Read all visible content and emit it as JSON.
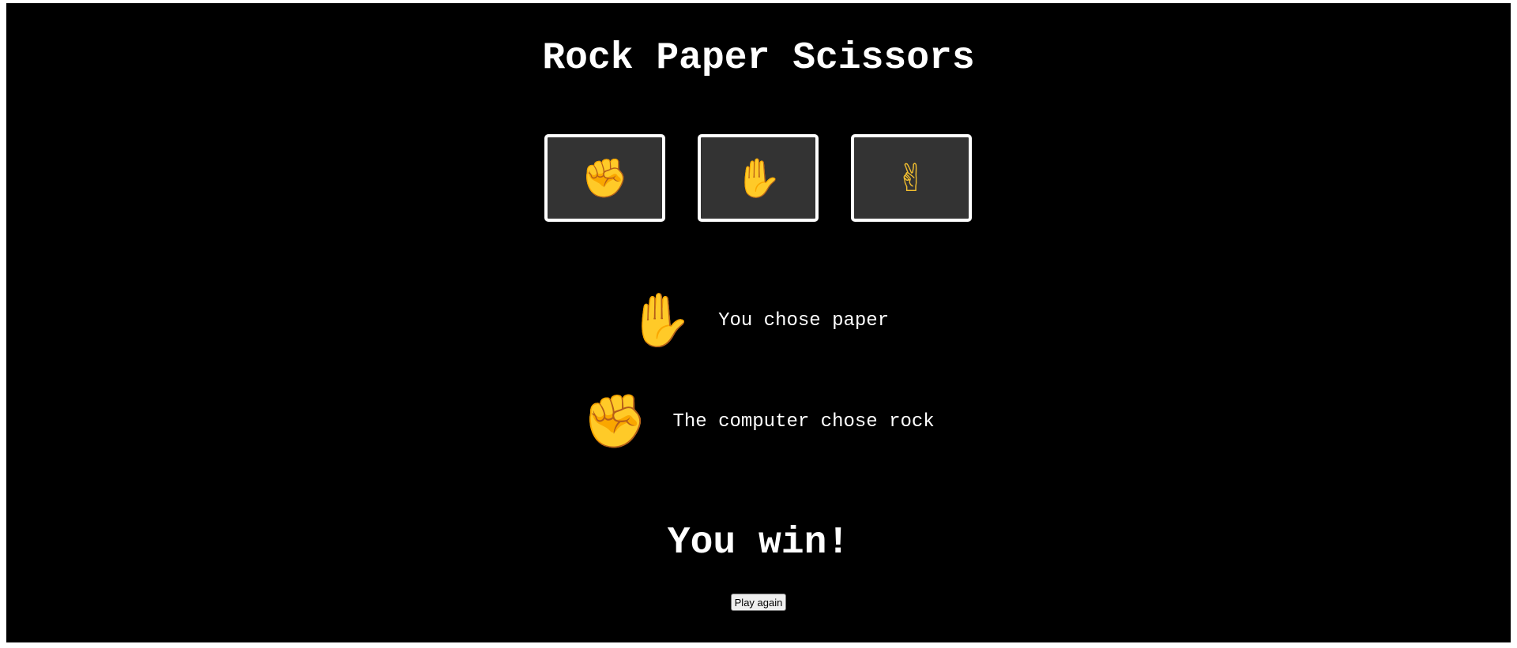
{
  "title": "Rock Paper Scissors",
  "choices": [
    {
      "name": "rock",
      "icon": "raised-fist-icon",
      "glyph": "✊"
    },
    {
      "name": "paper",
      "icon": "raised-hand-icon",
      "glyph": "✋"
    },
    {
      "name": "scissors",
      "icon": "victory-hand-icon",
      "glyph": "✌"
    }
  ],
  "player": {
    "icon": "raised-hand-icon",
    "glyph": "✋",
    "text": "You chose paper"
  },
  "computer": {
    "icon": "raised-fist-icon",
    "glyph": "✊",
    "text": "The computer chose rock"
  },
  "outcome": "You win!",
  "play_again_label": "Play again",
  "colors": {
    "background": "#000000",
    "button_fill": "#333333",
    "button_border": "#ffffff",
    "text": "#ffffff",
    "emoji": "#f4c02f"
  }
}
